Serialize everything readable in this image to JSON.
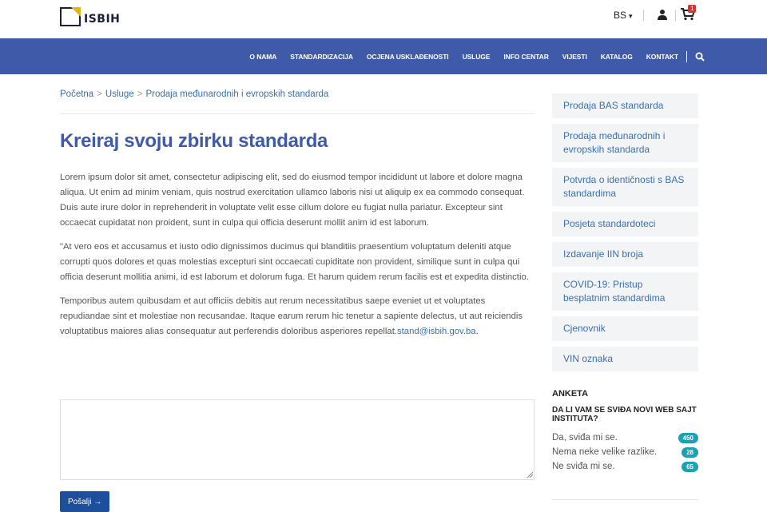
{
  "header": {
    "logo_text": "ISBIH",
    "language": "BS",
    "cart_count": "1"
  },
  "nav": {
    "items": [
      "O NAMA",
      "STANDARDIZACIJA",
      "OCJENA USKLAĐENOSTI",
      "USLUGE",
      "INFO CENTAR",
      "VIJESTI",
      "KATALOG",
      "KONTAKT"
    ]
  },
  "breadcrumb": {
    "items": [
      "Početna",
      "Usluge",
      "Prodaja međunarodnih i evropskih standarda"
    ],
    "separator": ">"
  },
  "main": {
    "title": "Kreiraj svoju zbirku standarda",
    "p1": "Lorem ipsum dolor sit amet, consectetur adipiscing elit, sed do eiusmod tempor incididunt ut labore et dolore magna aliqua. Ut enim ad minim veniam, quis nostrud exercitation ullamco laboris nisi ut aliquip ex ea commodo consequat. Duis aute irure dolor in reprehenderit in voluptate velit esse cillum dolore eu fugiat nulla pariatur. Excepteur sint occaecat cupidatat non proident, sunt in culpa qui officia deserunt mollit anim id est laborum.",
    "p2": "\"At vero eos et accusamus et iusto odio dignissimos ducimus qui blanditiis praesentium voluptatum deleniti atque corrupti quos dolores et quas molestias excepturi sint occaecati cupiditate non provident, similique sunt in culpa qui officia deserunt mollitia animi, id est laborum et dolorum fuga. Et harum quidem rerum facilis est et expedita distinctio.",
    "p3": "Temporibus autem quibusdam et aut officiis debitis aut rerum necessitatibus saepe eveniet ut et voluptates repudiandae sint et molestiae non recusandae. Itaque earum rerum hic tenetur a sapiente delectus, ut aut reiciendis voluptatibus maiores alias consequatur aut perferendis doloribus asperiores repellat.",
    "email": "stand@isbih.gov.ba",
    "p3_end": ".",
    "textarea_value": "",
    "submit_label": "Pošalji →"
  },
  "sidebar": {
    "items": [
      "Prodaja BAS standarda",
      "Prodaja međunarodnih i evropskih standarda",
      "Potvrda o identičnosti s BAS standardima",
      "Posjeta standardoteci",
      "Izdavanje IIN broja",
      "COVID-19: Pristup besplatnim standardima",
      "Cjenovnik",
      "VIN oznaka"
    ]
  },
  "poll": {
    "title": "ANKETA",
    "question": "DA LI VAM SE SVIĐA NOVI WEB SAJT INSTITUTA?",
    "options": [
      {
        "label": "Da, sviđa mi se.",
        "count": "450"
      },
      {
        "label": "Nema neke velike razlike.",
        "count": "28"
      },
      {
        "label": "Ne sviđa mi se.",
        "count": "65"
      }
    ]
  },
  "colors": {
    "nav_bg": "#3f5aa8",
    "link": "#3a6fb0",
    "badge": "#19a1b4",
    "cart_badge": "#d9302c",
    "button": "#1e4f9c"
  }
}
